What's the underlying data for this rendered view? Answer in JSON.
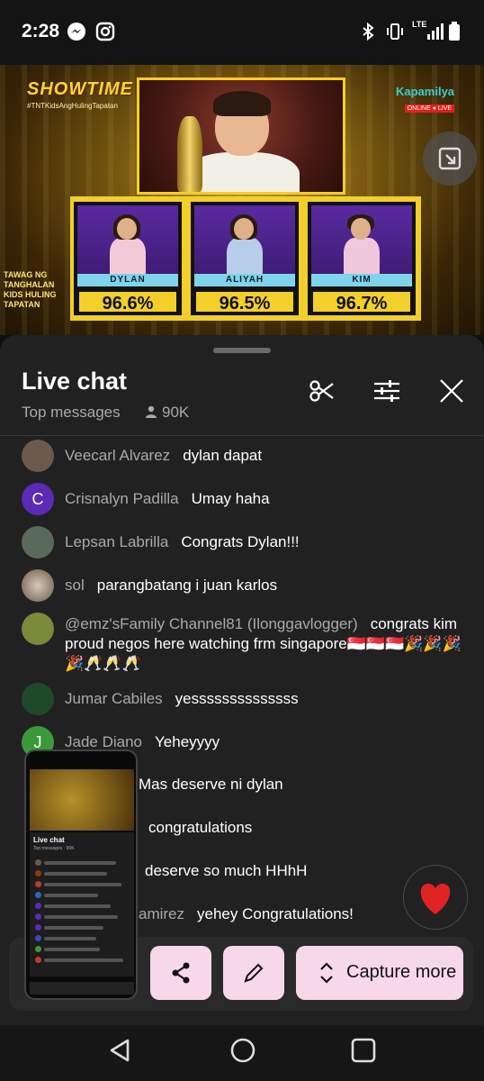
{
  "status_bar": {
    "time": "2:28",
    "icons": [
      "messenger-icon",
      "instagram-icon",
      "bluetooth-icon",
      "vibrate-icon",
      "lte-signal-icon",
      "battery-icon"
    ],
    "network": "LTE"
  },
  "video": {
    "show_logo": "SHOWTIME",
    "hashtag": "#TNTKidsAngHulingTapatan",
    "channel_logo": "Kapamilya",
    "channel_badge": "ONLINE ● LIVE",
    "side_logo": "TAWAG NG TANGHALAN KIDS HULING TAPATAN",
    "contestants": [
      {
        "name": "DYLAN",
        "score": "96.6%",
        "color": "#f5c8d8"
      },
      {
        "name": "ALIYAH",
        "score": "96.5%",
        "color": "#b8cdea"
      },
      {
        "name": "KIM",
        "score": "96.7%",
        "color": "#f0c8dc"
      }
    ]
  },
  "chat": {
    "title": "Live chat",
    "mode": "Top messages",
    "viewers": "90K",
    "messages": [
      {
        "author": "Veecarl Alvarez",
        "text": "dylan dapat",
        "avatar_color": "#6b5a4a",
        "initial": ""
      },
      {
        "author": "Crisnalyn Padilla",
        "text": "Umay haha",
        "avatar_color": "#5b2bb5",
        "initial": "C"
      },
      {
        "author": "Lepsan Labrilla",
        "text": "Congrats Dylan!!!",
        "avatar_color": "#5a6a5a",
        "initial": ""
      },
      {
        "author": "sol",
        "text": "parangbatang i juan karlos",
        "avatar_color": "#8a7a6a",
        "initial": ""
      },
      {
        "author": "@emz'sFamily Channel81 (Ilonggavlogger)",
        "text": "congrats kim proud negos here watching frm singapore🇸🇬🇸🇬🇸🇬🎉🎉🎉🎉🥂🥂🥂",
        "avatar_color": "#7a8a3a",
        "initial": ""
      },
      {
        "author": "Jumar Cabiles",
        "text": "yessssssssssssss",
        "avatar_color": "#1e4a2a",
        "initial": ""
      },
      {
        "author": "Jade Diano",
        "text": "Yeheyyyy",
        "avatar_color": "#3a9a3a",
        "initial": "J"
      },
      {
        "author": "",
        "text": "Mas deserve ni dylan",
        "avatar_color": "#444",
        "initial": ""
      },
      {
        "author": "",
        "text": "congratulations",
        "avatar_color": "#444",
        "initial": ""
      },
      {
        "author": "",
        "text": "deserve so much HHhH",
        "avatar_color": "#444",
        "initial": ""
      },
      {
        "author": "amirez",
        "text": "yehey Congratulations!",
        "avatar_color": "#444",
        "initial": ""
      }
    ]
  },
  "thumbnail": {
    "title": "Live chat",
    "sub": "Top messages · 90K"
  },
  "capture": {
    "share_icon": "share-icon",
    "edit_icon": "pencil-icon",
    "capture_more_label": "Capture more"
  },
  "colors": {
    "accent_button": "#f7d8ea",
    "score_gold": "#f2cf2a",
    "name_band": "#7fd3ea"
  }
}
